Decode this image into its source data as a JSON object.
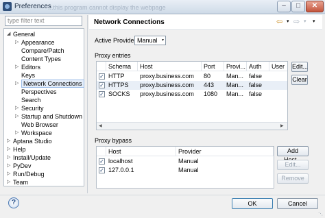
{
  "window": {
    "title": "Preferences",
    "background_text": "...this program cannot display the webpage"
  },
  "sidebar": {
    "filter_placeholder": "type filter text",
    "tree": [
      {
        "label": "General",
        "depth": 0,
        "expander": "◢"
      },
      {
        "label": "Appearance",
        "depth": 1,
        "expander": "▷"
      },
      {
        "label": "Compare/Patch",
        "depth": 1,
        "expander": ""
      },
      {
        "label": "Content Types",
        "depth": 1,
        "expander": ""
      },
      {
        "label": "Editors",
        "depth": 1,
        "expander": "▷"
      },
      {
        "label": "Keys",
        "depth": 1,
        "expander": ""
      },
      {
        "label": "Network Connections",
        "depth": 1,
        "expander": "▷",
        "selected": true
      },
      {
        "label": "Perspectives",
        "depth": 1,
        "expander": ""
      },
      {
        "label": "Search",
        "depth": 1,
        "expander": ""
      },
      {
        "label": "Security",
        "depth": 1,
        "expander": "▷"
      },
      {
        "label": "Startup and Shutdown",
        "depth": 1,
        "expander": "▷"
      },
      {
        "label": "Web Browser",
        "depth": 1,
        "expander": ""
      },
      {
        "label": "Workspace",
        "depth": 1,
        "expander": "▷"
      },
      {
        "label": "Aptana Studio",
        "depth": 0,
        "expander": "▷"
      },
      {
        "label": "Help",
        "depth": 0,
        "expander": "▷"
      },
      {
        "label": "Install/Update",
        "depth": 0,
        "expander": "▷"
      },
      {
        "label": "PyDev",
        "depth": 0,
        "expander": "▷"
      },
      {
        "label": "Run/Debug",
        "depth": 0,
        "expander": "▷"
      },
      {
        "label": "Team",
        "depth": 0,
        "expander": "▷"
      }
    ]
  },
  "panel": {
    "title": "Network Connections",
    "nav_back": "⇦",
    "nav_forward": "⇨",
    "dropdown": "▾",
    "active_provider_label": "Active Provider:",
    "active_provider_value": "Manual",
    "proxy_entries_label": "Proxy entries",
    "entries_columns": [
      "",
      "Schema",
      "Host",
      "Port",
      "Provi...",
      "Auth",
      "User"
    ],
    "entries_rows": [
      {
        "checked": true,
        "schema": "HTTP",
        "host": "proxy.business.com",
        "port": "80",
        "provider": "Man...",
        "auth": "false",
        "user": ""
      },
      {
        "checked": true,
        "schema": "HTTPS",
        "host": "proxy.business.com",
        "port": "443",
        "provider": "Man...",
        "auth": "false",
        "user": ""
      },
      {
        "checked": true,
        "schema": "SOCKS",
        "host": "proxy.business.com",
        "port": "1080",
        "provider": "Man...",
        "auth": "false",
        "user": ""
      }
    ],
    "edit_label": "Edit...",
    "clear_label": "Clear",
    "proxy_bypass_label": "Proxy bypass",
    "bypass_columns": [
      "",
      "Host",
      "Provider"
    ],
    "bypass_rows": [
      {
        "checked": true,
        "host": "localhost",
        "provider": "Manual"
      },
      {
        "checked": true,
        "host": "127.0.0.1",
        "provider": "Manual"
      }
    ],
    "add_host_label": "Add Host...",
    "bypass_edit_label": "Edit...",
    "remove_label": "Remove"
  },
  "footer": {
    "help_label": "?",
    "ok_label": "OK",
    "cancel_label": "Cancel"
  }
}
